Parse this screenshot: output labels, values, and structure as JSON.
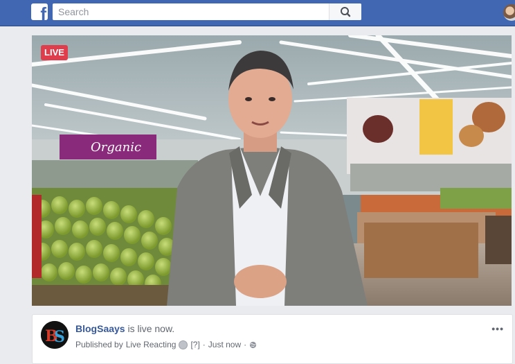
{
  "topbar": {
    "logo_letter": "f",
    "search_placeholder": "Search",
    "search_value": ""
  },
  "video": {
    "live_label": "LIVE",
    "store_sign": "Organic"
  },
  "post": {
    "author": "BlogSaays",
    "status": "is live now.",
    "published_prefix": "Published by",
    "publisher": "Live Reacting",
    "tag": "[?]",
    "separator": "·",
    "time": "Just now",
    "separator2": "·",
    "more": "•••",
    "avatar_initials": "BS"
  },
  "colors": {
    "topbar": "#4267b2",
    "live": "#e03d4c",
    "link": "#365899"
  },
  "icons": {
    "logo": "facebook-logo-icon",
    "search": "search-icon",
    "privacy": "globe-icon",
    "more": "more-options-icon"
  }
}
